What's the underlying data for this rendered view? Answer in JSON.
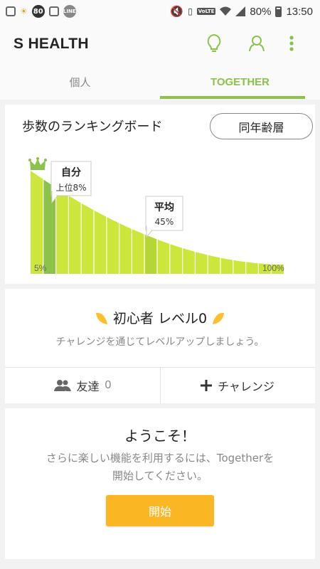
{
  "status_bar": {
    "badge": "80",
    "line_label": "LINE",
    "volte": "VoLTE",
    "battery": "80%",
    "time": "13:50"
  },
  "app": {
    "title": "S HEALTH",
    "icons": [
      "lightbulb-icon",
      "person-icon",
      "more-icon"
    ]
  },
  "tabs": [
    {
      "label": "個人",
      "active": false
    },
    {
      "label": "TOGETHER",
      "active": true
    }
  ],
  "ranking": {
    "title": "歩数のランキングボード",
    "filter_button": "同年齢層",
    "me": {
      "label": "自分",
      "value": "上位8%"
    },
    "average": {
      "label": "平均",
      "value": "45%"
    },
    "axis_min": "5%",
    "axis_max": "100%"
  },
  "level": {
    "title": "初心者 レベル0",
    "subtitle": "チャレンジを通じてレベルアップしましょう。",
    "friends_label": "友達",
    "friends_count": "0",
    "challenge_label": "チャレンジ"
  },
  "welcome": {
    "title": "ようこそ！",
    "line1": "さらに楽しい機能を利用するには、Togetherを",
    "line2": "開始してください。",
    "button": "開始"
  },
  "colors": {
    "accent": "#8bc34a",
    "bar": "#cde63c",
    "bar_highlight": "#8bc34a",
    "start_button": "#fbb623"
  }
}
